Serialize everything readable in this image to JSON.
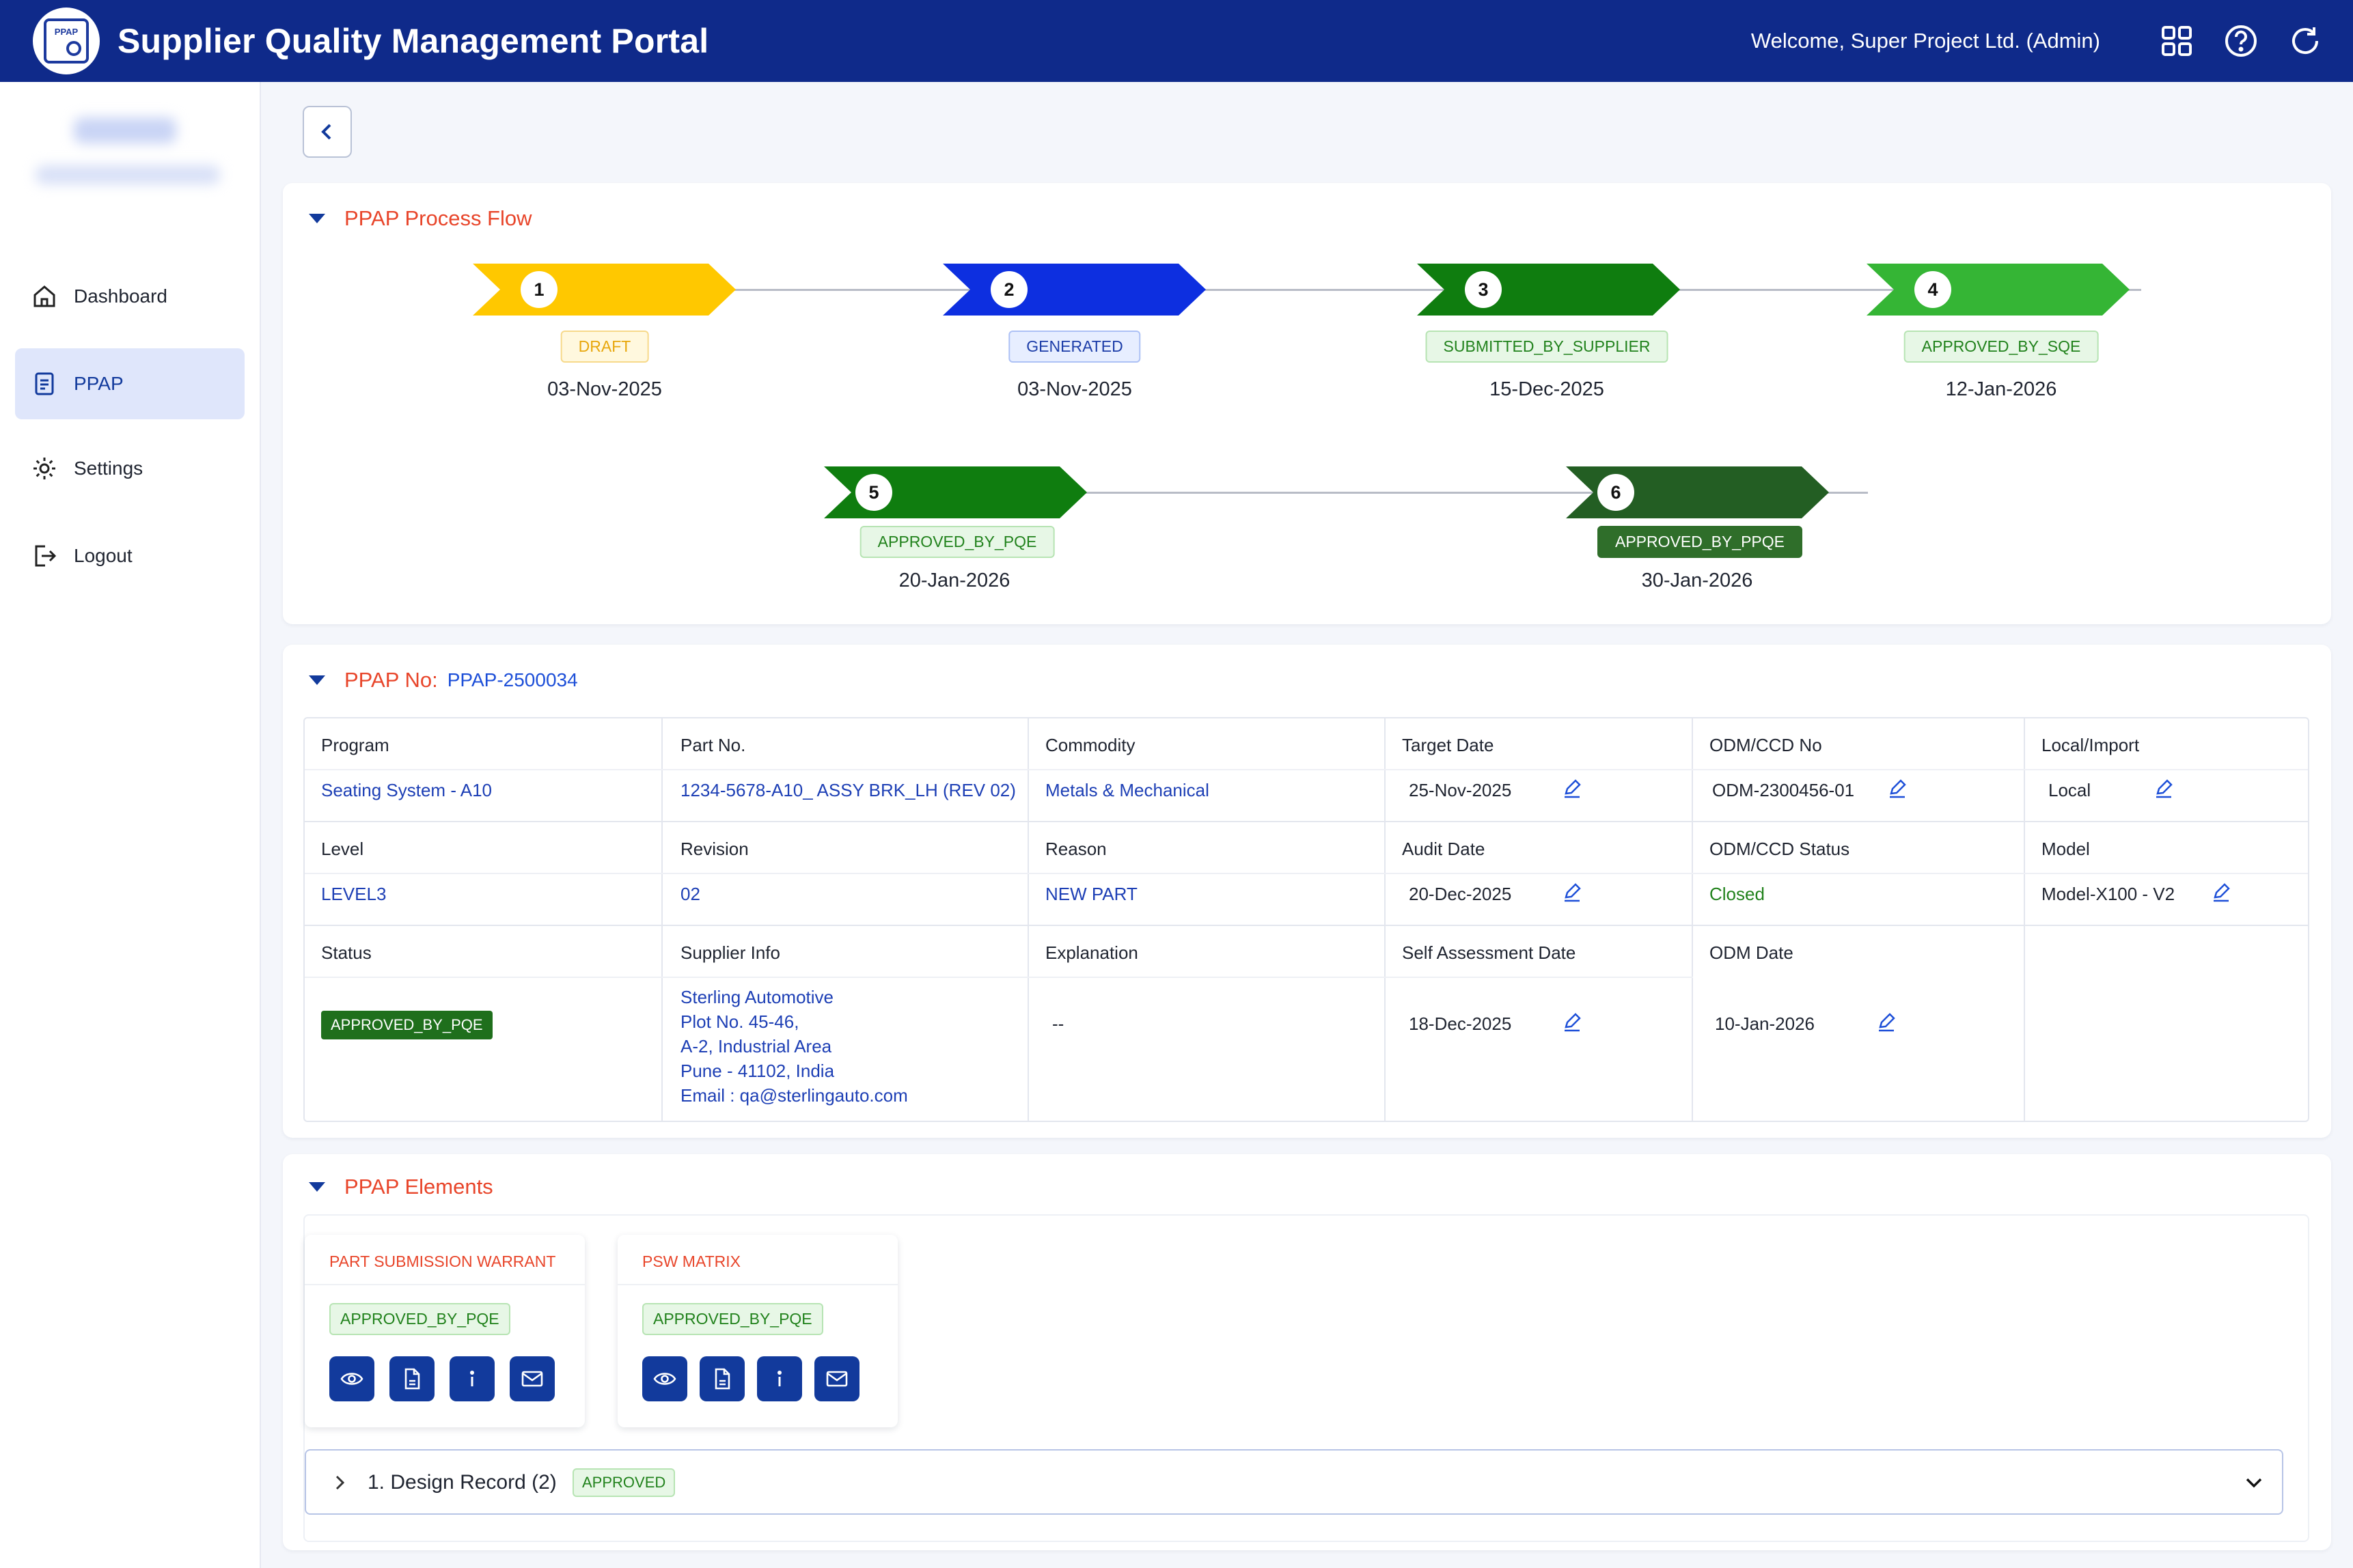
{
  "app": {
    "title": "Supplier Quality Management Portal",
    "logo_text": "PPAP",
    "welcome": "Welcome, Super Project Ltd. (Admin)"
  },
  "header_icons": [
    "grid-icon",
    "help-icon",
    "refresh-icon"
  ],
  "sidebar": {
    "items": [
      {
        "label": "Dashboard",
        "icon": "home-icon"
      },
      {
        "label": "PPAP",
        "icon": "document-icon",
        "active": true
      },
      {
        "label": "Settings",
        "icon": "gear-icon"
      },
      {
        "label": "Logout",
        "icon": "logout-icon"
      }
    ]
  },
  "flow": {
    "title": "PPAP Process Flow",
    "steps": [
      {
        "num": "1",
        "status": "DRAFT",
        "date": "03-Nov-2025",
        "color": "#ffc800"
      },
      {
        "num": "2",
        "status": "GENERATED",
        "date": "03-Nov-2025",
        "color": "#0d2fe0"
      },
      {
        "num": "3",
        "status": "SUBMITTED_BY_SUPPLIER",
        "date": "15-Dec-2025",
        "color": "#0f7d0f"
      },
      {
        "num": "4",
        "status": "APPROVED_BY_SQE",
        "date": "12-Jan-2026",
        "color": "#35b535"
      },
      {
        "num": "5",
        "status": "APPROVED_BY_PQE",
        "date": "20-Jan-2026",
        "color": "#0f7d0f"
      },
      {
        "num": "6",
        "status": "APPROVED_BY_PPQE",
        "date": "30-Jan-2026",
        "color": "#235e23"
      }
    ]
  },
  "ppap": {
    "label": "PPAP No:",
    "number": "PPAP-2500034",
    "row1": {
      "program": {
        "label": "Program",
        "value": "Seating System - A10"
      },
      "part_no": {
        "label": "Part No.",
        "value": "1234-5678-A10_ ASSY BRK_LH (REV 02)"
      },
      "commodity": {
        "label": "Commodity",
        "value": "Metals & Mechanical"
      },
      "target_date": {
        "label": "Target Date",
        "value": "25-Nov-2025"
      },
      "odm_ccd_no": {
        "label": "ODM/CCD No",
        "value": "ODM-2300456-01"
      },
      "local_import": {
        "label": "Local/Import",
        "value": "Local"
      }
    },
    "row2": {
      "level": {
        "label": "Level",
        "value": "LEVEL3"
      },
      "revision": {
        "label": "Revision",
        "value": "02"
      },
      "reason": {
        "label": "Reason",
        "value": "NEW PART"
      },
      "audit_date": {
        "label": "Audit Date",
        "value": "20-Dec-2025"
      },
      "odm_ccd_status": {
        "label": "ODM/CCD Status",
        "value": "Closed"
      },
      "model": {
        "label": "Model",
        "value": "Model-X100 - V2"
      }
    },
    "row3": {
      "status": {
        "label": "Status",
        "value": "APPROVED_BY_PQE"
      },
      "supplier": {
        "label": "Supplier Info",
        "lines": [
          "Sterling Automotive",
          "Plot No. 45-46,",
          "A-2, Industrial Area",
          "Pune - 41102, India",
          "Email : qa@sterlingauto.com"
        ]
      },
      "explanation": {
        "label": "Explanation",
        "value": "--"
      },
      "self_assessment_date": {
        "label": "Self Assessment Date",
        "value": "18-Dec-2025"
      },
      "odm_date": {
        "label": "ODM Date",
        "value": "10-Jan-2026"
      }
    }
  },
  "elements": {
    "title": "PPAP Elements",
    "cards": [
      {
        "title": "PART SUBMISSION WARRANT",
        "status": "APPROVED_BY_PQE"
      },
      {
        "title": "PSW MATRIX",
        "status": "APPROVED_BY_PQE"
      }
    ],
    "actions": [
      "eye-icon",
      "file-icon",
      "info-icon",
      "mail-icon"
    ],
    "accordion": {
      "title": "1. Design Record (2)",
      "status": "APPROVED"
    }
  }
}
